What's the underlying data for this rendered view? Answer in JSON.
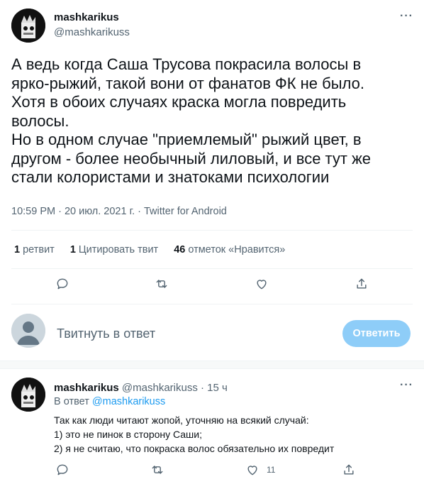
{
  "tweet": {
    "author_name": "mashkarikus",
    "author_handle": "@mashkarikuss",
    "text": "А ведь когда Саша Трусова покрасила волосы в\nярко-рыжий, такой вони от фанатов ФК не было.\nХотя в обоих случаях краска могла повредить\nволосы.\nНо в одном случае \"приемлемый\" рыжий цвет, в\nдругом - более необычный лиловый, и все тут же\nстали колористами и знатоками психологии",
    "meta": "10:59 PM · 20 июл. 2021 г. · Twitter for Android",
    "stats": {
      "retweets_count": "1",
      "retweets_label": "ретвит",
      "quotes_count": "1",
      "quotes_label": "Цитировать твит",
      "likes_count": "46",
      "likes_label": "отметок «Нравится»"
    },
    "more_icon": "more-dots-icon"
  },
  "reply_composer": {
    "placeholder": "Твитнуть в ответ",
    "button_label": "Ответить",
    "button_color": "#8ecdf8"
  },
  "reply_tweet": {
    "author_name": "mashkarikus",
    "author_handle": "@mashkarikuss",
    "time": "15 ч",
    "reply_to_prefix": "В ответ",
    "reply_to_handle": "@mashkarikuss",
    "text": "Так как люди читают жопой, уточняю на всякий случай:\n1) это не пинок в сторону Саши;\n2) я не считаю, что покраска волос обязательно их повредит",
    "like_count": "11"
  },
  "colors": {
    "link": "#1d9bf0",
    "secondary_text": "#536471",
    "primary_text": "#0f1419"
  }
}
